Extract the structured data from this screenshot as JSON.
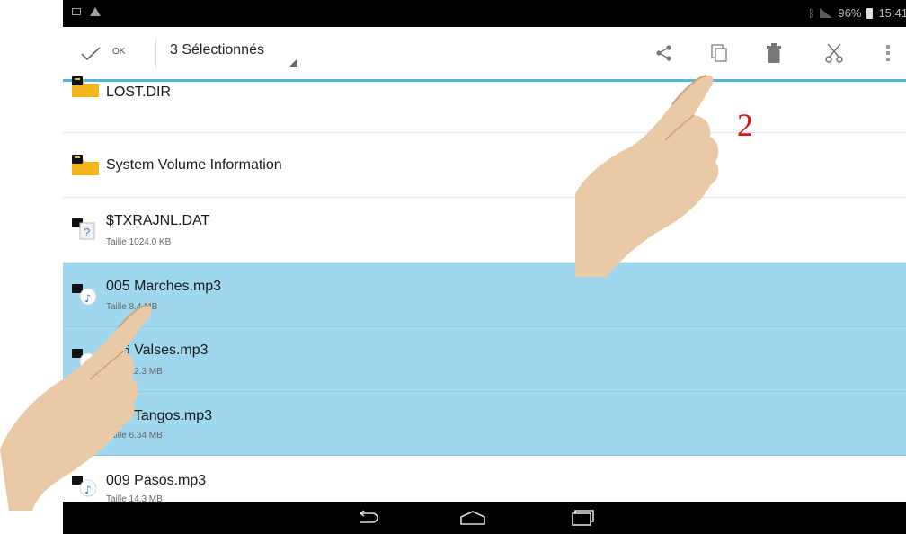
{
  "status_bar": {
    "battery": "96%",
    "time": "15:41"
  },
  "action_bar": {
    "ok_label": "OK",
    "selection_label": "3 Sélectionnés"
  },
  "files": [
    {
      "name": "LOST.DIR",
      "size": "",
      "type": "folder",
      "selected": false
    },
    {
      "name": "System Volume Information",
      "size": "",
      "type": "folder",
      "selected": false
    },
    {
      "name": "$TXRAJNL.DAT",
      "size": "Taille 1024.0 KB",
      "type": "unknown",
      "selected": false
    },
    {
      "name": "005 Marches.mp3",
      "size": "Taille 8.4 MB",
      "type": "audio",
      "selected": true
    },
    {
      "name": "006 Valses.mp3",
      "size": "Taille 12.3 MB",
      "type": "audio",
      "selected": true
    },
    {
      "name": "008 Tangos.mp3",
      "size": "Taille 6.34 MB",
      "type": "audio",
      "selected": true
    },
    {
      "name": "009 Pasos.mp3",
      "size": "Taille 14.3 MB",
      "type": "audio",
      "selected": false
    }
  ],
  "annotation": {
    "step_number": "2"
  },
  "colors": {
    "selection": "#9fd7ee",
    "accent": "#53b5dd",
    "annotation": "#e01010"
  }
}
